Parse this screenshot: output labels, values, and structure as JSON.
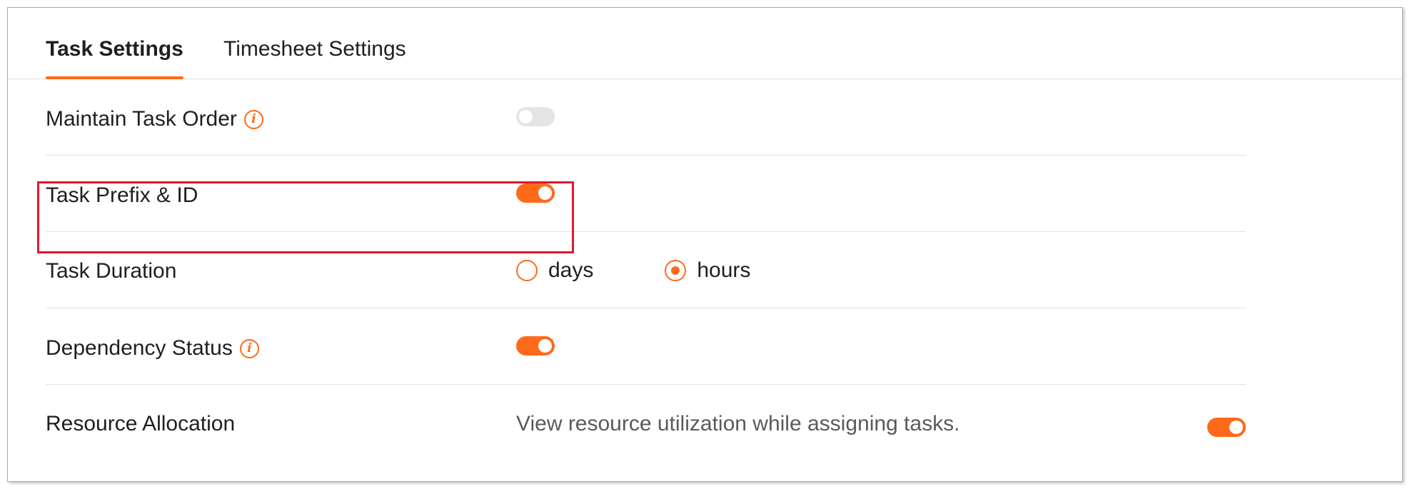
{
  "tabs": [
    {
      "label": "Task Settings",
      "active": true
    },
    {
      "label": "Timesheet Settings",
      "active": false
    }
  ],
  "settings": [
    {
      "label": "Maintain Task Order",
      "info_icon": "info-icon",
      "control": "toggle",
      "enabled": false
    },
    {
      "label": "Task Prefix & ID",
      "control": "toggle",
      "enabled": true,
      "highlighted": true
    },
    {
      "label": "Task Duration",
      "control": "radio",
      "options": [
        {
          "label": "days",
          "selected": false
        },
        {
          "label": "hours",
          "selected": true
        }
      ]
    },
    {
      "label": "Dependency Status",
      "info_icon": "info-icon",
      "control": "toggle",
      "enabled": true
    },
    {
      "label": "Resource Allocation",
      "description": "View resource utilization while assigning tasks.",
      "control": "toggle",
      "enabled": true
    }
  ],
  "colors": {
    "accent": "#ff6a1a",
    "toggle_off": "#e4e4e4",
    "highlight_border": "#e0182d",
    "divider": "#e3e3e3"
  }
}
